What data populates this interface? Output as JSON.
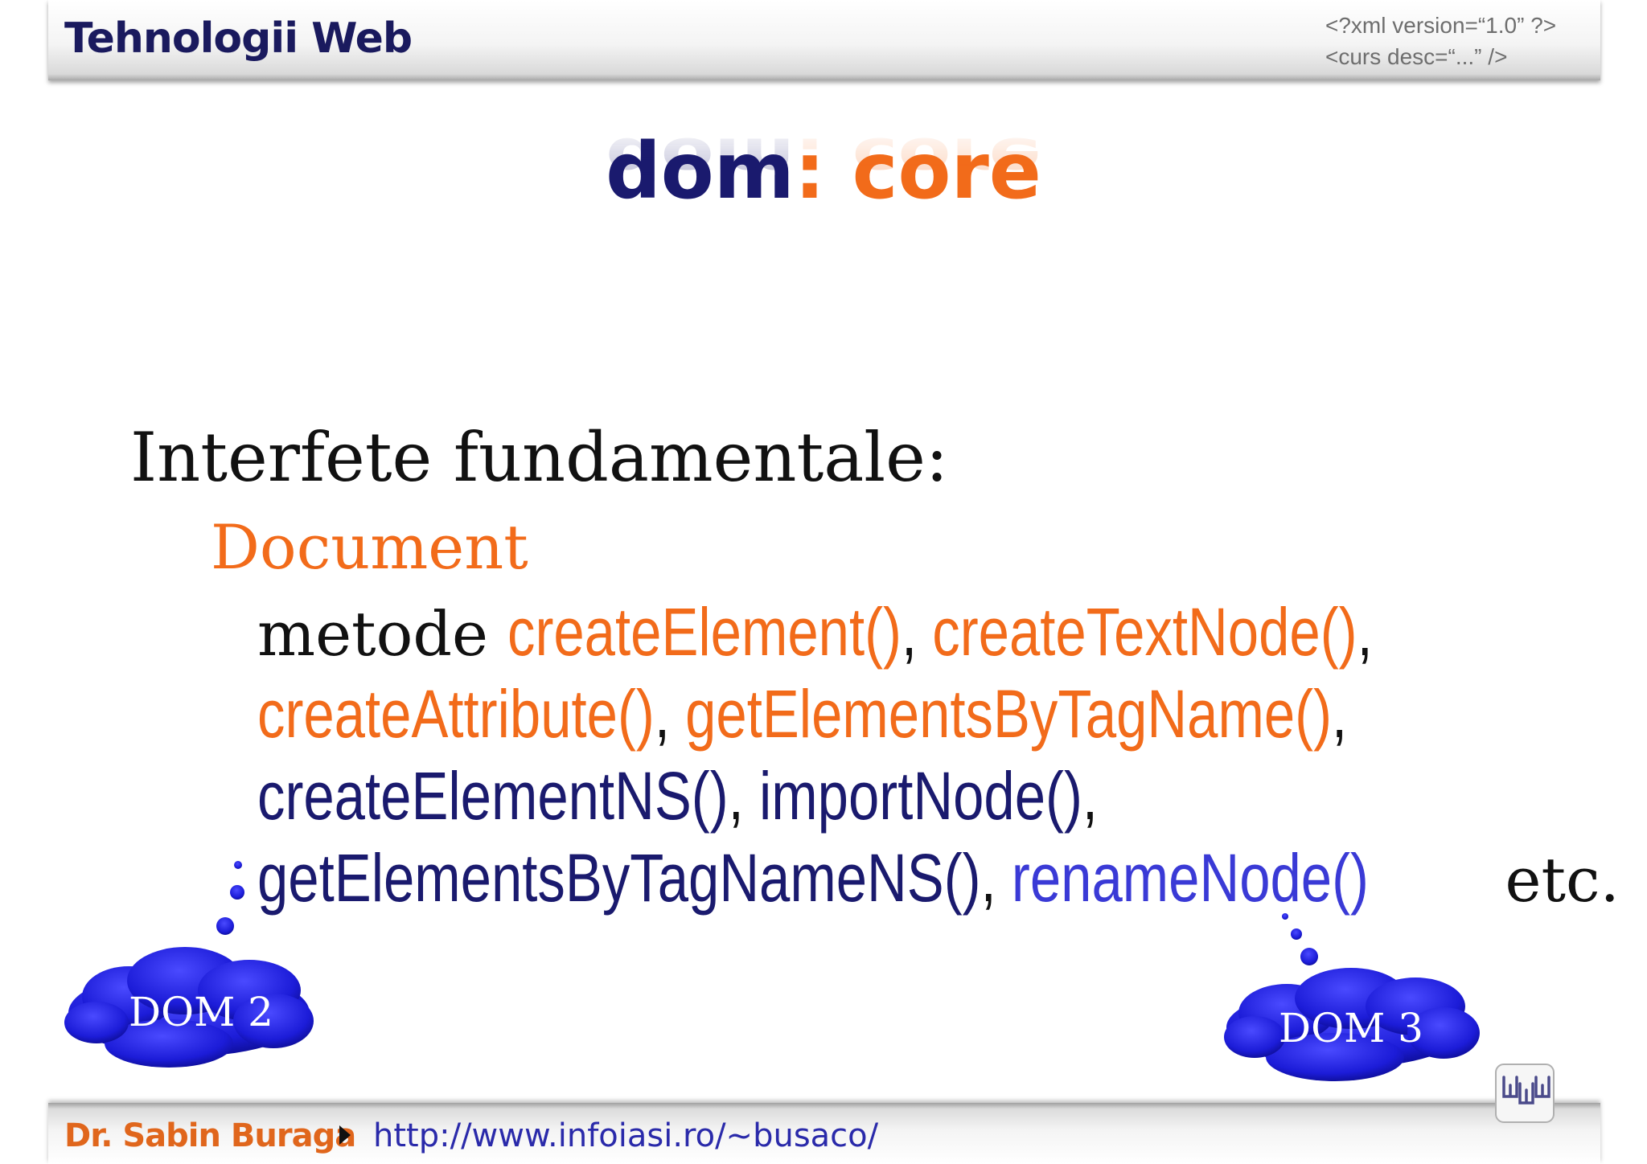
{
  "header": {
    "course_title": "Tehnologii Web",
    "code_line1": "<?xml version=“1.0” ?>",
    "code_line2": "<curs desc=“...” />"
  },
  "slide": {
    "title_part1": "dom",
    "title_part2": ": core",
    "heading": "Interfete fundamentale:",
    "interface_name": "Document",
    "methods_prefix": "metode ",
    "method_createElement": "createElement()",
    "sep_comma": ", ",
    "method_createTextNode": "createTextNode()",
    "end_comma": ",",
    "method_createAttribute": "createAttribute()",
    "method_getElementsByTagName": "getElementsByTagName()",
    "method_createElementNS": "createElementNS()",
    "method_importNode": "importNode()",
    "method_getElementsByTagNameNS": "getElementsByTagNameNS()",
    "method_renameNode": "renameNode()",
    "etc": " etc.",
    "cloud_dom2": "DOM 2",
    "cloud_dom3": "DOM 3"
  },
  "footer": {
    "author": "Dr. Sabin Buraga",
    "url": "http://www.infoiasi.ro/~busaco/"
  },
  "colors": {
    "navy": "#1a1a6e",
    "orange": "#f26b1a",
    "blue": "#3a3ad6",
    "cloud": "#2a2ae0"
  }
}
